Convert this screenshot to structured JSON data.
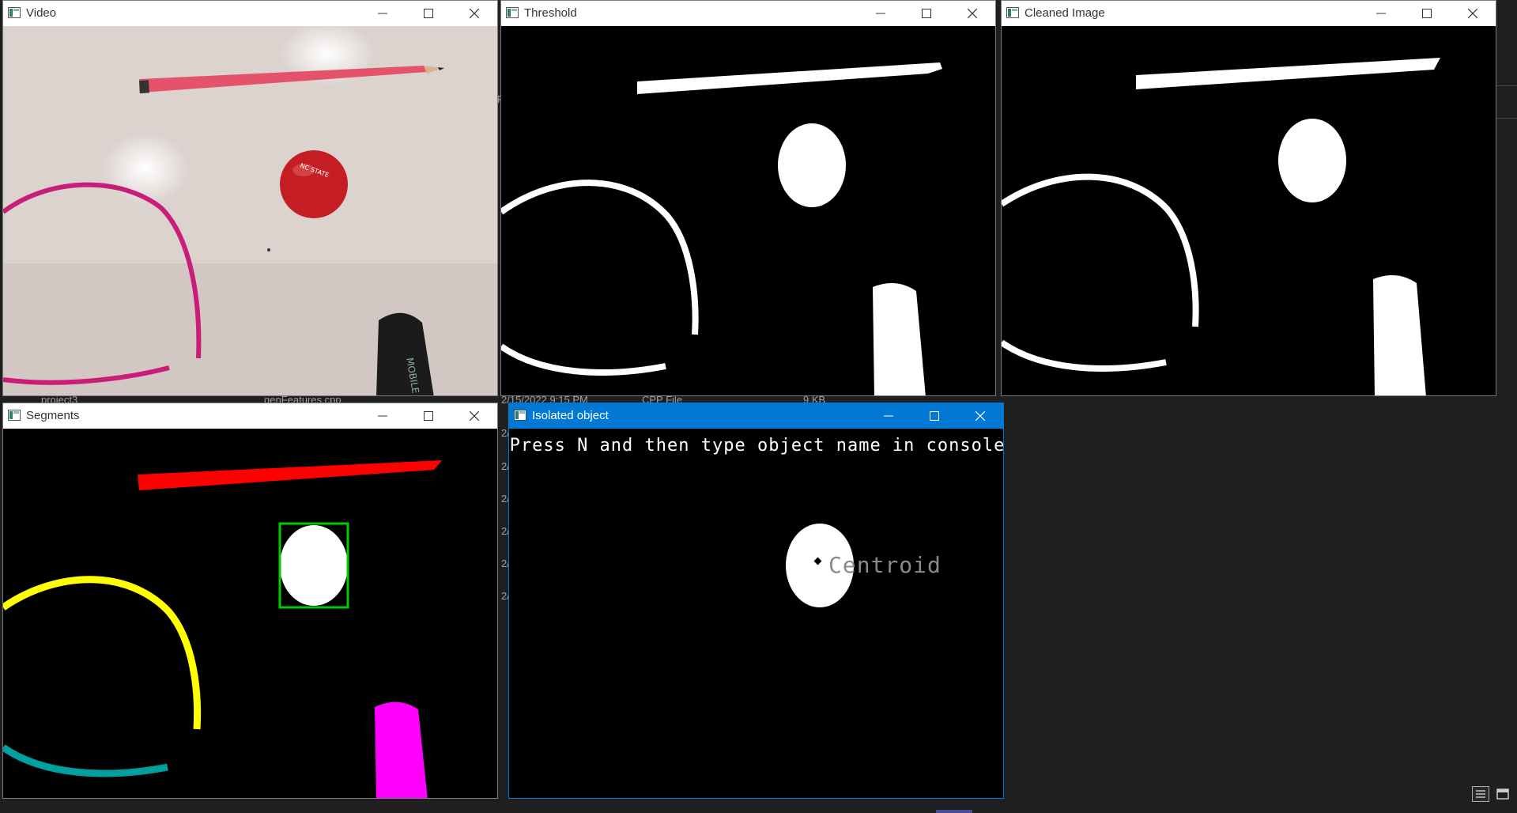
{
  "background": {
    "explorer_row": {
      "folder": "project3",
      "file": "genFeatures.cpp",
      "date": "2/15/2022 9:15 PM",
      "type": "CPP File",
      "size": "9 KB"
    },
    "date_fragments": [
      "2/",
      "2/",
      "2/",
      "2/",
      "2/",
      "2/"
    ],
    "bracket_fragment": "F"
  },
  "windows": {
    "video": {
      "title": "Video"
    },
    "threshold": {
      "title": "Threshold"
    },
    "cleaned": {
      "title": "Cleaned Image"
    },
    "segments": {
      "title": "Segments"
    },
    "isolated": {
      "title": "Isolated object",
      "instruction": "Press N and then type object name in console",
      "centroid_label": "Centroid"
    }
  },
  "segment_colors": {
    "pencil": "#ff0000",
    "headband": "#ffff00",
    "ball": "#ffffff",
    "marker": "#ff00ff",
    "second_arc": "#00a0a0",
    "bounding_box": "#00cc00"
  },
  "accent_color": "#0078d4",
  "icons": [
    "window-icon",
    "minimize-icon",
    "maximize-icon",
    "close-icon",
    "list-view-icon",
    "tile-view-icon"
  ]
}
